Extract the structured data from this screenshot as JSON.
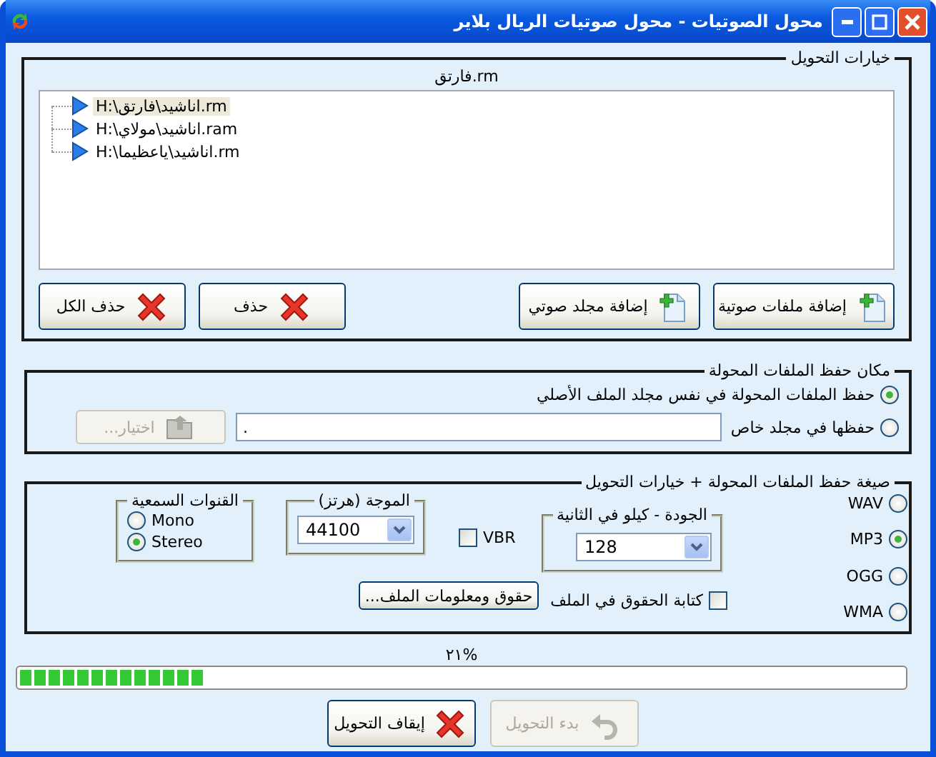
{
  "window": {
    "title": "محول الصوتيات - محول صوتيات الريال بلاير"
  },
  "conversion_options": {
    "title": "خيارات التحويل",
    "current_file": "فارتق.rm",
    "files": [
      {
        "path": "H:\\اناشيد\\فارتق.rm",
        "selected": true
      },
      {
        "path": "H:\\اناشيد\\مولاي.ram",
        "selected": false
      },
      {
        "path": "H:\\اناشيد\\ياعظيما.rm",
        "selected": false
      }
    ],
    "buttons": [
      {
        "label": "إضافة ملفات صوتية",
        "kind": "add"
      },
      {
        "label": "إضافة مجلد صوتي",
        "kind": "add"
      },
      {
        "label": "حذف",
        "kind": "delete"
      },
      {
        "label": "حذف الكل",
        "kind": "delete"
      }
    ]
  },
  "save_location": {
    "title": "مكان حفظ الملفات المحولة",
    "options": [
      {
        "label": "حفظ الملفات المحولة في نفس مجلد الملف الأصلي",
        "selected": true
      },
      {
        "label": "حفظها في مجلد خاص",
        "selected": false
      }
    ],
    "folder_field": {
      "value": "."
    },
    "browse_button": {
      "label": "اختيار...",
      "disabled": true
    }
  },
  "format": {
    "title": "صيغة حفظ الملفات المحولة + خيارات التحويل",
    "formats": [
      {
        "label": "WAV",
        "selected": false
      },
      {
        "label": "MP3",
        "selected": true
      },
      {
        "label": "OGG",
        "selected": false
      },
      {
        "label": "WMA",
        "selected": false
      }
    ],
    "quality": {
      "title": "الجودة - كيلو في الثانية",
      "value": "128"
    },
    "vbr": {
      "label": "VBR",
      "checked": false
    },
    "frequency": {
      "title": "الموجة (هرتز)",
      "value": "44100"
    },
    "channels": {
      "title": "القنوات السمعية",
      "options": [
        {
          "label": "Mono",
          "selected": false
        },
        {
          "label": "Stereo",
          "selected": true
        }
      ]
    },
    "write_tags": {
      "label": "كتابة الحقوق في الملف",
      "checked": false
    },
    "tags_button": {
      "label": "حقوق ومعلومات الملف..."
    }
  },
  "progress": {
    "reading": "%٢١",
    "level": 0.21
  },
  "actions": [
    {
      "label": "بدء التحويل",
      "kind": "start",
      "disabled": true
    },
    {
      "label": "إيقاف التحويل",
      "kind": "stop",
      "disabled": false
    }
  ]
}
